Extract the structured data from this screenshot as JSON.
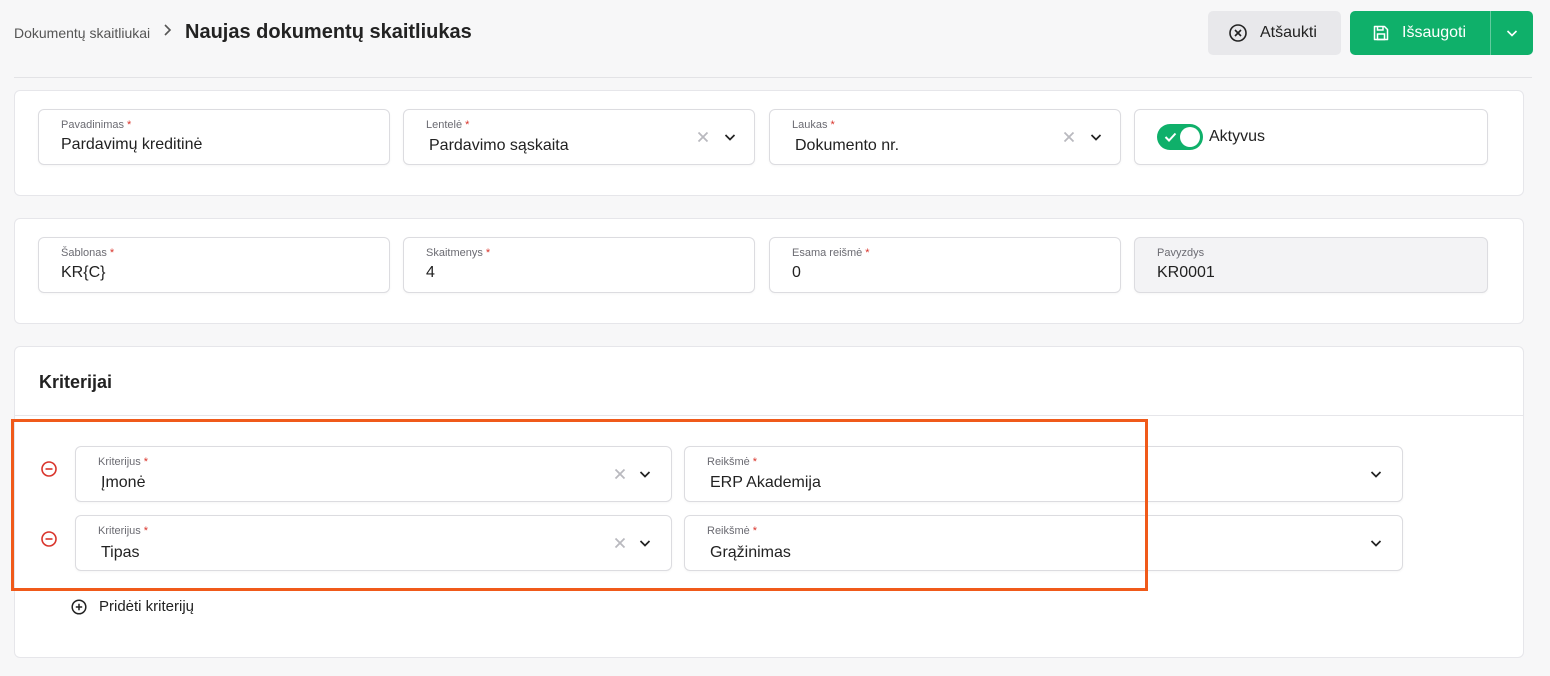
{
  "header": {
    "breadcrumb_parent": "Dokumentų skaitliukai",
    "title": "Naujas dokumentų skaitliukas",
    "cancel_label": "Atšaukti",
    "save_label": "Išsaugoti"
  },
  "general": {
    "name": {
      "label": "Pavadinimas",
      "value": "Pardavimų kreditinė"
    },
    "table": {
      "label": "Lentelė",
      "value": "Pardavimo sąskaita"
    },
    "field": {
      "label": "Laukas",
      "value": "Dokumento nr."
    },
    "active": {
      "label": "Aktyvus",
      "value": true
    }
  },
  "numbering": {
    "template": {
      "label": "Šablonas",
      "value": "KR{C}"
    },
    "digits": {
      "label": "Skaitmenys",
      "value": "4"
    },
    "current": {
      "label": "Esama reišmė",
      "value": "0"
    },
    "example": {
      "label": "Pavyzdys",
      "value": "KR0001"
    }
  },
  "criteria": {
    "title": "Kriterijai",
    "rows": [
      {
        "criterion_label": "Kriterijus",
        "criterion_value": "Įmonė",
        "value_label": "Reikšmė",
        "value": "ERP Akademija"
      },
      {
        "criterion_label": "Kriterijus",
        "criterion_value": "Tipas",
        "value_label": "Reikšmė",
        "value": "Grąžinimas"
      }
    ],
    "add_label": "Pridėti kriterijų"
  },
  "required_mark": "*",
  "colors": {
    "accent": "#0fb06a",
    "required": "#d9342b",
    "remove": "#d9342b",
    "highlight": "#f05a1a"
  }
}
